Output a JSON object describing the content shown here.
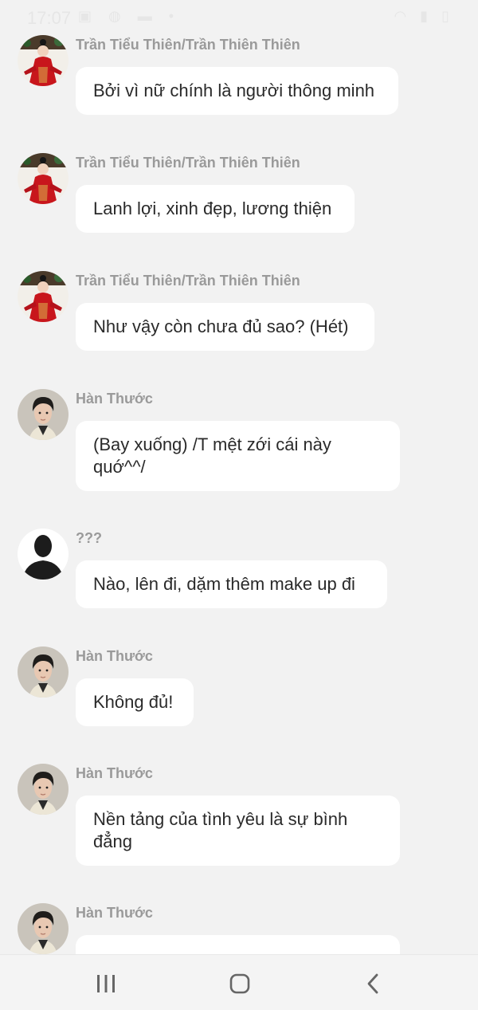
{
  "status_bar": {
    "time": "17:07"
  },
  "messages": [
    {
      "sender": "Trần Tiểu Thiên/Trần Thiên Thiên",
      "avatar": "red-dress-woman-avatar",
      "text": "Bởi vì nữ chính là người thông minh"
    },
    {
      "sender": "Trần Tiểu Thiên/Trần Thiên Thiên",
      "avatar": "red-dress-woman-avatar",
      "text": "Lanh lợi, xinh đẹp, lương thiện"
    },
    {
      "sender": "Trần Tiểu Thiên/Trần Thiên Thiên",
      "avatar": "red-dress-woman-avatar",
      "text": "Như vậy còn chưa đủ sao? (Hét)"
    },
    {
      "sender": "Hàn Thước",
      "avatar": "young-man-avatar",
      "text": "(Bay xuống) /T mệt zới cái này quớ^^/"
    },
    {
      "sender": "???",
      "avatar": "silhouette-avatar",
      "text": "Nào, lên đi, dặm thêm make up đi"
    },
    {
      "sender": "Hàn Thước",
      "avatar": "young-man-avatar",
      "text": "Không đủ!"
    },
    {
      "sender": "Hàn Thước",
      "avatar": "young-man-avatar",
      "text": "Nền tảng của tình yêu là sự bình đẳng"
    },
    {
      "sender": "Hàn Thước",
      "avatar": "young-man-avatar",
      "text": ""
    }
  ],
  "nav_bar": {
    "recent_icon": "recent-apps-icon",
    "home_icon": "home-icon",
    "back_icon": "back-icon"
  }
}
